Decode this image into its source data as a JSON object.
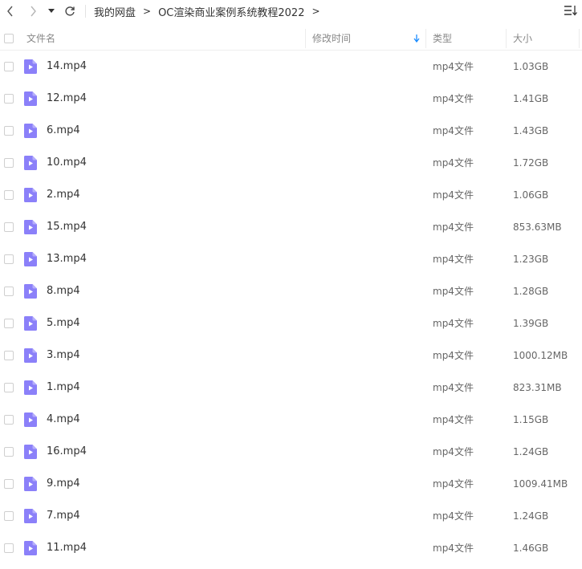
{
  "breadcrumb": [
    "我的网盘",
    "OC渲染商业案例系统教程2022"
  ],
  "breadcrumb_separator": ">",
  "columns": {
    "name": "文件名",
    "modified": "修改时间",
    "type": "类型",
    "size": "大小"
  },
  "colors": {
    "accent": "#1a8cff",
    "file_icon": "#8b80f9"
  },
  "files": [
    {
      "name": "14.mp4",
      "type": "mp4文件",
      "size": "1.03GB"
    },
    {
      "name": "12.mp4",
      "type": "mp4文件",
      "size": "1.41GB"
    },
    {
      "name": "6.mp4",
      "type": "mp4文件",
      "size": "1.43GB"
    },
    {
      "name": "10.mp4",
      "type": "mp4文件",
      "size": "1.72GB"
    },
    {
      "name": "2.mp4",
      "type": "mp4文件",
      "size": "1.06GB"
    },
    {
      "name": "15.mp4",
      "type": "mp4文件",
      "size": "853.63MB"
    },
    {
      "name": "13.mp4",
      "type": "mp4文件",
      "size": "1.23GB"
    },
    {
      "name": "8.mp4",
      "type": "mp4文件",
      "size": "1.28GB"
    },
    {
      "name": "5.mp4",
      "type": "mp4文件",
      "size": "1.39GB"
    },
    {
      "name": "3.mp4",
      "type": "mp4文件",
      "size": "1000.12MB"
    },
    {
      "name": "1.mp4",
      "type": "mp4文件",
      "size": "823.31MB"
    },
    {
      "name": "4.mp4",
      "type": "mp4文件",
      "size": "1.15GB"
    },
    {
      "name": "16.mp4",
      "type": "mp4文件",
      "size": "1.24GB"
    },
    {
      "name": "9.mp4",
      "type": "mp4文件",
      "size": "1009.41MB"
    },
    {
      "name": "7.mp4",
      "type": "mp4文件",
      "size": "1.24GB"
    },
    {
      "name": "11.mp4",
      "type": "mp4文件",
      "size": "1.46GB"
    }
  ]
}
